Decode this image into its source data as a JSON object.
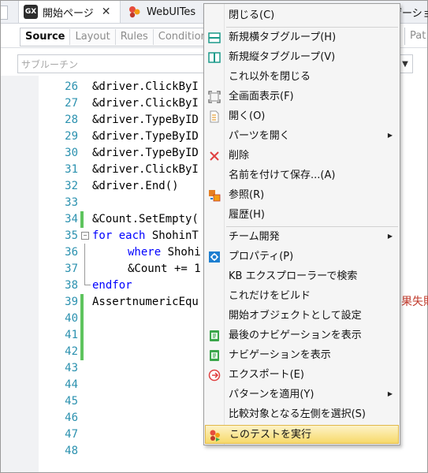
{
  "tabs": {
    "main_label": "開始ページ",
    "main_logo": "GX",
    "second_label": "WebUITes",
    "far_label": "ゲーション"
  },
  "subtabs": {
    "items": [
      "Source",
      "Layout",
      "Rules",
      "Condition"
    ],
    "right_item": "Pat"
  },
  "subroutine": {
    "placeholder": "サブルーチン"
  },
  "editor": {
    "lines": [
      {
        "num": "26",
        "text": "&driver.ClickByI"
      },
      {
        "num": "27",
        "text": "&driver.ClickByI"
      },
      {
        "num": "28",
        "text": "&driver.TypeByID"
      },
      {
        "num": "29",
        "text": "&driver.TypeByID"
      },
      {
        "num": "30",
        "text": "&driver.TypeByID"
      },
      {
        "num": "31",
        "text": "&driver.ClickByI"
      },
      {
        "num": "32",
        "text": "&driver.End()"
      },
      {
        "num": "33",
        "text": ""
      },
      {
        "num": "34",
        "text": "&Count.SetEmpty("
      },
      {
        "num": "35",
        "text_kw1": "for each ",
        "text_obj": "ShohinT"
      },
      {
        "num": "36",
        "text_kw1": "where ",
        "text_obj": "Shohi"
      },
      {
        "num": "37",
        "text": "&Count += 1"
      },
      {
        "num": "38",
        "text_kw1": "endfor"
      },
      {
        "num": "39",
        "text": "AssertnumericEqu",
        "trail": "果失敗"
      },
      {
        "num": "40",
        "text": ""
      },
      {
        "num": "41",
        "text": ""
      },
      {
        "num": "42",
        "text": ""
      },
      {
        "num": "43",
        "text": ""
      },
      {
        "num": "44",
        "text": ""
      },
      {
        "num": "45",
        "text": ""
      },
      {
        "num": "46",
        "text": ""
      },
      {
        "num": "47",
        "text": ""
      },
      {
        "num": "48",
        "text": ""
      }
    ]
  },
  "context_menu": {
    "items": {
      "close": "閉じる(C)",
      "new_h_group": "新規横タブグループ(H)",
      "new_v_group": "新規縦タブグループ(V)",
      "close_others": "これ以外を閉じる",
      "fullscreen": "全画面表示(F)",
      "open": "開く(O)",
      "open_parts": "パーツを開く",
      "delete": "削除",
      "save_as": "名前を付けて保存...(A)",
      "references": "参照(R)",
      "history": "履歴(H)",
      "team_dev": "チーム開発",
      "properties": "プロパティ(P)",
      "kb_search": "KB エクスプローラーで検索",
      "build_only": "これだけをビルド",
      "set_startup": "開始オブジェクトとして設定",
      "show_last_nav": "最後のナビゲーションを表示",
      "show_nav": "ナビゲーションを表示",
      "export": "エクスポート(E)",
      "apply_pattern": "パターンを適用(Y)",
      "select_left": "比較対象となる左側を選択(S)",
      "run_test": "このテストを実行"
    },
    "highlighted": "run_test"
  },
  "colors": {
    "line_numbers": "#2b91af",
    "keyword": "#0000ff",
    "change_bar": "#5ec45e",
    "menu_highlight": "#f7d96a",
    "delete_icon": "#e04040",
    "icon_blue": "#1e7fd0",
    "icon_green": "#3aa64a"
  }
}
